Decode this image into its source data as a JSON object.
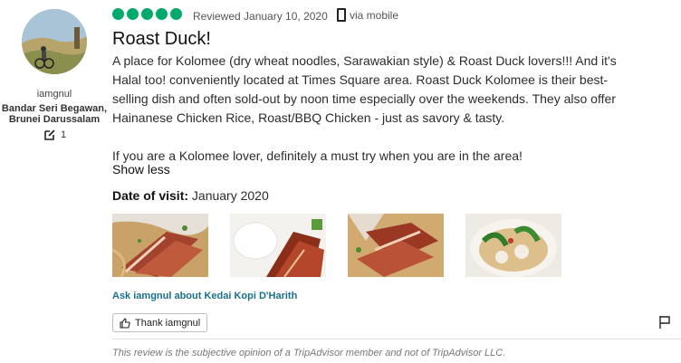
{
  "reviewer": {
    "username": "iamgnul",
    "location": "Bandar Seri Begawan, Brunei Darussalam",
    "contributions": "1"
  },
  "review": {
    "rating": 5,
    "reviewed_date": "Reviewed January 10, 2020",
    "via": "via mobile",
    "title": "Roast Duck!",
    "text": "A place for Kolomee (dry wheat noodles, Sarawakian style) & Roast Duck lovers!!! And it's\nHalal too! conveniently located at Times Square area. Roast Duck Kolomee is their best-\nselling dish and often sold-out by noon time especially over the weekends. They also offer\nHainanese Chicken Rice, Roast/BBQ Chicken - just as savory & tasty.\n\nIf you are a Kolomee lover, definitely a must try when you are in the area!",
    "show_less": "Show less",
    "date_of_visit_label": "Date of visit:",
    "date_of_visit_value": "January 2020",
    "ask_link": "Ask iamgnul about Kedai Kopi D'Harith",
    "thank_button": "Thank iamgnul",
    "disclaimer": "This review is the subjective opinion of a TripAdvisor member and not of TripAdvisor LLC."
  },
  "colors": {
    "rating_bubble": "#00aa6c",
    "link": "#1a6f8e"
  },
  "icons": [
    "phone-icon",
    "edit-icon",
    "thumbs-up-icon",
    "flag-icon"
  ]
}
